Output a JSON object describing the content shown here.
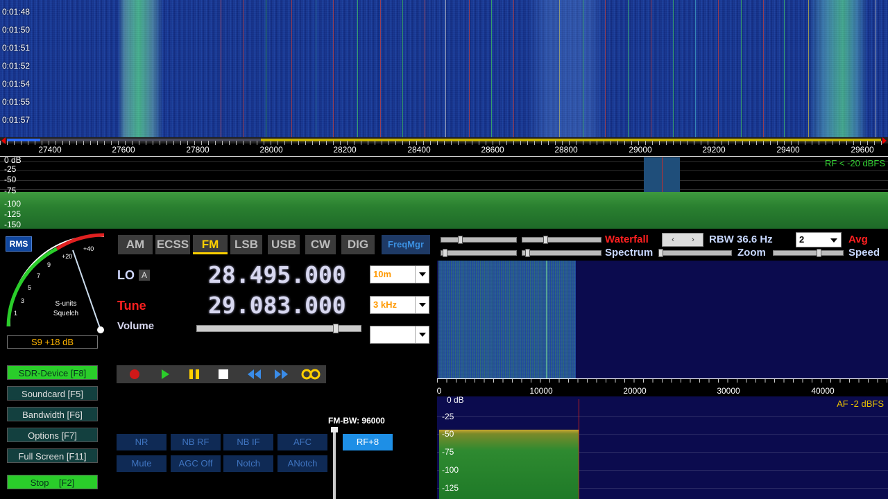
{
  "waterfall": {
    "times": [
      "0:01:48",
      "0:01:50",
      "0:01:51",
      "0:01:52",
      "0:01:54",
      "0:01:55",
      "0:01:57"
    ]
  },
  "freq_scale": {
    "labels": [
      "27400",
      "27600",
      "27800",
      "28000",
      "28200",
      "28400",
      "28600",
      "28800",
      "29000",
      "29200",
      "29400",
      "29600"
    ]
  },
  "spectrum": {
    "db_labels": [
      "0 dB",
      "-25",
      "-50",
      "-75",
      "-100",
      "-125",
      "-150"
    ],
    "rf_status": "RF < -20 dBFS"
  },
  "meter": {
    "rms_label": "RMS",
    "scale_labels": [
      "1",
      "3",
      "5",
      "7",
      "9",
      "+20",
      "+40"
    ],
    "label_line1": "S-units",
    "label_line2": "Squelch",
    "readout": "S9 +18 dB"
  },
  "side_buttons": {
    "sdr_device": "SDR-Device [F8]",
    "soundcard": "Soundcard [F5]",
    "bandwidth": "Bandwidth [F6]",
    "options": "Options [F7]",
    "full_screen": "Full Screen [F11]",
    "stop": "Stop    [F2]"
  },
  "modes": [
    "AM",
    "ECSS",
    "FM",
    "LSB",
    "USB",
    "CW",
    "DIG"
  ],
  "active_mode": "FM",
  "freq_mgr": "FreqMgr",
  "lo": {
    "label": "LO",
    "tag": "A",
    "value": "28.495.000",
    "band": "10m"
  },
  "tune": {
    "label": "Tune",
    "value": "29.083.000",
    "step": "3 kHz"
  },
  "volume": {
    "label": "Volume",
    "level": 0.83
  },
  "blank_select": "",
  "filters": {
    "row1": [
      "NR",
      "NB RF",
      "NB IF",
      "AFC",
      "RF+8"
    ],
    "row2": [
      "Mute",
      "AGC Off",
      "Notch",
      "ANotch"
    ],
    "fm_bw": "FM-BW: 96000"
  },
  "af_panel": {
    "waterfall_label": "Waterfall",
    "spectrum_label": "Spectrum",
    "zoom_label": "Zoom",
    "speed_label": "Speed",
    "rbw": "RBW 36.6 Hz",
    "avg_value": "2",
    "avg_label": "Avg",
    "freq_labels": [
      "0",
      "10000",
      "20000",
      "30000",
      "40000"
    ],
    "db_labels": [
      "0 dB",
      "-25",
      "-50",
      "-75",
      "-100",
      "-125"
    ],
    "af_level": "AF  -2 dBFS"
  },
  "colors": {
    "accent_green": "#2acd2a",
    "mode_active": "#ffd000",
    "tune_red": "#ff2020",
    "readout_orange": "#ffb400"
  }
}
